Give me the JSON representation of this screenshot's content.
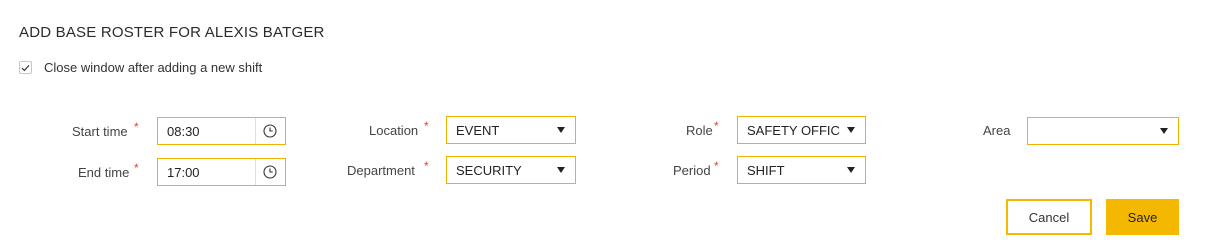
{
  "dialog": {
    "title": "ADD BASE ROSTER FOR ALEXIS BATGER",
    "close_window_checkbox": {
      "label": "Close window after adding a new shift",
      "checked": true
    }
  },
  "fields": {
    "start_time": {
      "label": "Start time",
      "required_mark": "*",
      "value": "08:30",
      "icon": "clock-icon"
    },
    "end_time": {
      "label": "End time",
      "required_mark": "*",
      "value": "17:00",
      "icon": "clock-icon"
    },
    "location": {
      "label": "Location",
      "required_mark": "*",
      "value": "EVENT"
    },
    "department": {
      "label": "Department",
      "required_mark": "*",
      "value": "SECURITY"
    },
    "role": {
      "label": "Role",
      "required_mark": "*",
      "value": "SAFETY OFFIC"
    },
    "period": {
      "label": "Period",
      "required_mark": "*",
      "value": "SHIFT"
    },
    "area": {
      "label": "Area",
      "value": ""
    }
  },
  "actions": {
    "cancel_label": "Cancel",
    "save_label": "Save"
  },
  "colors": {
    "accent": "#f5b800",
    "required": "#e34234",
    "input_border": "#f0b400"
  }
}
